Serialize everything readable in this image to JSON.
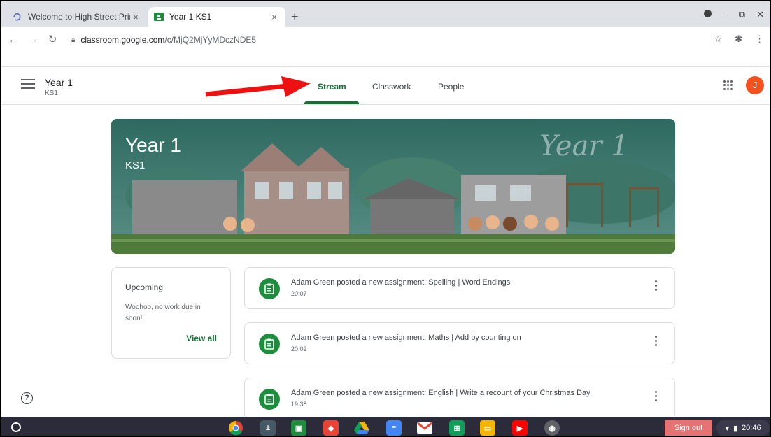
{
  "browser": {
    "tabs": [
      {
        "title": "Welcome to High Street Primary",
        "close": "×"
      },
      {
        "title": "Year 1 KS1",
        "close": "×"
      }
    ],
    "new_tab": "+",
    "url_host": "classroom.google.com",
    "url_path": "/c/MjQ2MjYyMDczNDE5"
  },
  "classroom": {
    "class_title": "Year 1",
    "class_subtitle": "KS1",
    "nav_tabs": [
      "Stream",
      "Classwork",
      "People"
    ],
    "avatar_letter": "J",
    "accent_color": "#137333"
  },
  "banner": {
    "title": "Year 1",
    "subtitle": "KS1",
    "art_text": "Year 1"
  },
  "upcoming": {
    "title": "Upcoming",
    "message": "Woohoo, no work due in soon!",
    "view_all": "View all"
  },
  "posts": [
    {
      "text": "Adam Green posted a new assignment: Spelling | Word Endings",
      "time": "20:07"
    },
    {
      "text": "Adam Green posted a new assignment: Maths | Add by counting on",
      "time": "20:02"
    },
    {
      "text": "Adam Green posted a new assignment: English | Write a recount of your Christmas Day",
      "time": "19:38"
    }
  ],
  "shelf": {
    "sign_out": "Sign out",
    "clock": "20:46"
  }
}
